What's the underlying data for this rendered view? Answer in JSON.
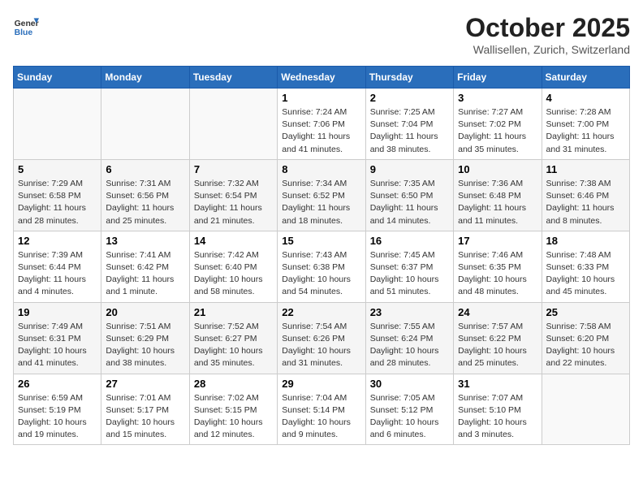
{
  "header": {
    "logo_line1": "General",
    "logo_line2": "Blue",
    "month": "October 2025",
    "location": "Wallisellen, Zurich, Switzerland"
  },
  "days_of_week": [
    "Sunday",
    "Monday",
    "Tuesday",
    "Wednesday",
    "Thursday",
    "Friday",
    "Saturday"
  ],
  "weeks": [
    [
      {
        "day": "",
        "info": ""
      },
      {
        "day": "",
        "info": ""
      },
      {
        "day": "",
        "info": ""
      },
      {
        "day": "1",
        "info": "Sunrise: 7:24 AM\nSunset: 7:06 PM\nDaylight: 11 hours\nand 41 minutes."
      },
      {
        "day": "2",
        "info": "Sunrise: 7:25 AM\nSunset: 7:04 PM\nDaylight: 11 hours\nand 38 minutes."
      },
      {
        "day": "3",
        "info": "Sunrise: 7:27 AM\nSunset: 7:02 PM\nDaylight: 11 hours\nand 35 minutes."
      },
      {
        "day": "4",
        "info": "Sunrise: 7:28 AM\nSunset: 7:00 PM\nDaylight: 11 hours\nand 31 minutes."
      }
    ],
    [
      {
        "day": "5",
        "info": "Sunrise: 7:29 AM\nSunset: 6:58 PM\nDaylight: 11 hours\nand 28 minutes."
      },
      {
        "day": "6",
        "info": "Sunrise: 7:31 AM\nSunset: 6:56 PM\nDaylight: 11 hours\nand 25 minutes."
      },
      {
        "day": "7",
        "info": "Sunrise: 7:32 AM\nSunset: 6:54 PM\nDaylight: 11 hours\nand 21 minutes."
      },
      {
        "day": "8",
        "info": "Sunrise: 7:34 AM\nSunset: 6:52 PM\nDaylight: 11 hours\nand 18 minutes."
      },
      {
        "day": "9",
        "info": "Sunrise: 7:35 AM\nSunset: 6:50 PM\nDaylight: 11 hours\nand 14 minutes."
      },
      {
        "day": "10",
        "info": "Sunrise: 7:36 AM\nSunset: 6:48 PM\nDaylight: 11 hours\nand 11 minutes."
      },
      {
        "day": "11",
        "info": "Sunrise: 7:38 AM\nSunset: 6:46 PM\nDaylight: 11 hours\nand 8 minutes."
      }
    ],
    [
      {
        "day": "12",
        "info": "Sunrise: 7:39 AM\nSunset: 6:44 PM\nDaylight: 11 hours\nand 4 minutes."
      },
      {
        "day": "13",
        "info": "Sunrise: 7:41 AM\nSunset: 6:42 PM\nDaylight: 11 hours\nand 1 minute."
      },
      {
        "day": "14",
        "info": "Sunrise: 7:42 AM\nSunset: 6:40 PM\nDaylight: 10 hours\nand 58 minutes."
      },
      {
        "day": "15",
        "info": "Sunrise: 7:43 AM\nSunset: 6:38 PM\nDaylight: 10 hours\nand 54 minutes."
      },
      {
        "day": "16",
        "info": "Sunrise: 7:45 AM\nSunset: 6:37 PM\nDaylight: 10 hours\nand 51 minutes."
      },
      {
        "day": "17",
        "info": "Sunrise: 7:46 AM\nSunset: 6:35 PM\nDaylight: 10 hours\nand 48 minutes."
      },
      {
        "day": "18",
        "info": "Sunrise: 7:48 AM\nSunset: 6:33 PM\nDaylight: 10 hours\nand 45 minutes."
      }
    ],
    [
      {
        "day": "19",
        "info": "Sunrise: 7:49 AM\nSunset: 6:31 PM\nDaylight: 10 hours\nand 41 minutes."
      },
      {
        "day": "20",
        "info": "Sunrise: 7:51 AM\nSunset: 6:29 PM\nDaylight: 10 hours\nand 38 minutes."
      },
      {
        "day": "21",
        "info": "Sunrise: 7:52 AM\nSunset: 6:27 PM\nDaylight: 10 hours\nand 35 minutes."
      },
      {
        "day": "22",
        "info": "Sunrise: 7:54 AM\nSunset: 6:26 PM\nDaylight: 10 hours\nand 31 minutes."
      },
      {
        "day": "23",
        "info": "Sunrise: 7:55 AM\nSunset: 6:24 PM\nDaylight: 10 hours\nand 28 minutes."
      },
      {
        "day": "24",
        "info": "Sunrise: 7:57 AM\nSunset: 6:22 PM\nDaylight: 10 hours\nand 25 minutes."
      },
      {
        "day": "25",
        "info": "Sunrise: 7:58 AM\nSunset: 6:20 PM\nDaylight: 10 hours\nand 22 minutes."
      }
    ],
    [
      {
        "day": "26",
        "info": "Sunrise: 6:59 AM\nSunset: 5:19 PM\nDaylight: 10 hours\nand 19 minutes."
      },
      {
        "day": "27",
        "info": "Sunrise: 7:01 AM\nSunset: 5:17 PM\nDaylight: 10 hours\nand 15 minutes."
      },
      {
        "day": "28",
        "info": "Sunrise: 7:02 AM\nSunset: 5:15 PM\nDaylight: 10 hours\nand 12 minutes."
      },
      {
        "day": "29",
        "info": "Sunrise: 7:04 AM\nSunset: 5:14 PM\nDaylight: 10 hours\nand 9 minutes."
      },
      {
        "day": "30",
        "info": "Sunrise: 7:05 AM\nSunset: 5:12 PM\nDaylight: 10 hours\nand 6 minutes."
      },
      {
        "day": "31",
        "info": "Sunrise: 7:07 AM\nSunset: 5:10 PM\nDaylight: 10 hours\nand 3 minutes."
      },
      {
        "day": "",
        "info": ""
      }
    ]
  ]
}
